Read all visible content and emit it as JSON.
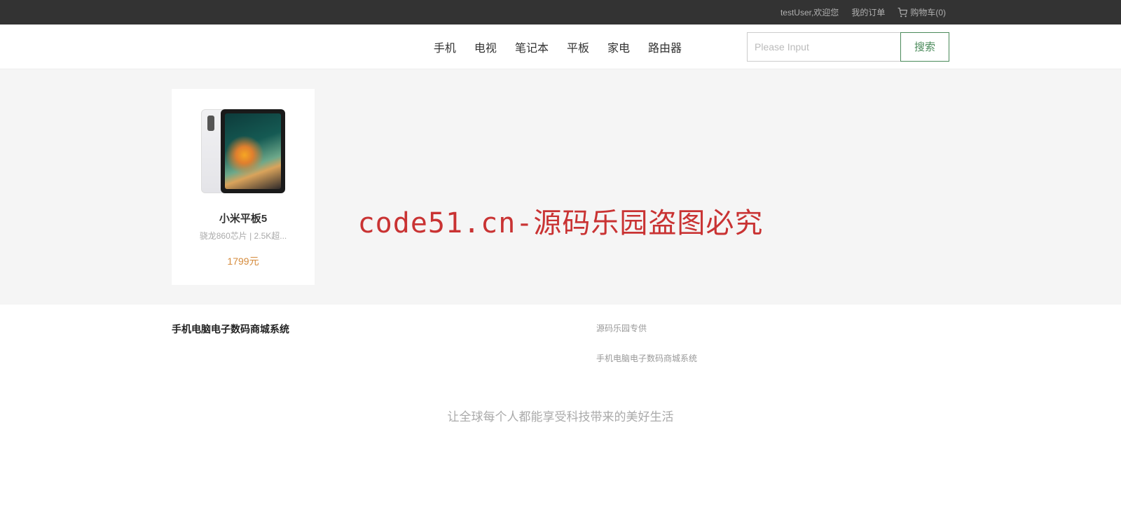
{
  "topbar": {
    "welcome": "testUser,欢迎您",
    "orders": "我的订单",
    "cart": "购物车(0)"
  },
  "nav": {
    "categories": [
      "手机",
      "电视",
      "笔记本",
      "平板",
      "家电",
      "路由器"
    ]
  },
  "search": {
    "placeholder": "Please Input",
    "button": "搜索"
  },
  "product": {
    "title": "小米平板5",
    "desc": "骁龙860芯片 | 2.5K超...",
    "price": "1799元"
  },
  "watermark": "code51.cn-源码乐园盗图必究",
  "footer": {
    "left_title": "手机电脑电子数码商城系统",
    "right1": "源码乐园专供",
    "right2": "手机电脑电子数码商城系统",
    "slogan": "让全球每个人都能享受科技带来的美好生活"
  }
}
